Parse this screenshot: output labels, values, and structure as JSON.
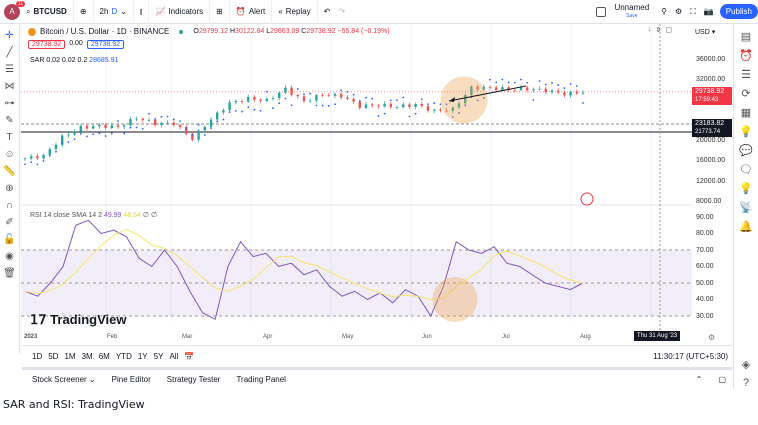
{
  "toolbar": {
    "avatar": "A",
    "badge": "11",
    "symbol": "BTCUSD",
    "interval": "2h",
    "interval_alt": "D",
    "indicators": "Indicators",
    "alert": "Alert",
    "replay": "Replay",
    "layout_name": "Unnamed",
    "save": "Save",
    "publish": "Publish"
  },
  "legend": {
    "title": "Bitcoin / U.S. Dollar · 1D · BINANCE",
    "open_label": "O",
    "open": "29799.12",
    "high_label": "H",
    "high": "30122.84",
    "low_label": "L",
    "low": "29663.09",
    "close_label": "C",
    "close": "29738.92",
    "change": "−55.84 (−0.19%)",
    "bid": "29738.92",
    "spread": "0.00",
    "ask": "29738.92",
    "sar_label": "SAR 0.02 0.02 0.2",
    "sar_value": "28685.91"
  },
  "rsi_legend": {
    "label": "RSI 14 close SMA 14 2",
    "rsi": "49.99",
    "sma": "46.54",
    "extra": "∅ ∅"
  },
  "price_axis": {
    "currency": "USD",
    "ticks": [
      "36000.00",
      "32000.00",
      "20000.00",
      "16000.00",
      "12000.00",
      "8000.00"
    ],
    "last_price": "29738.92",
    "countdown": "17:59:43",
    "cross_price": "23183.82",
    "cross_sub": "21773.74"
  },
  "rsi_axis": {
    "ticks": [
      "90.00",
      "80.00",
      "70.00",
      "60.00",
      "50.00",
      "40.00",
      "30.00"
    ]
  },
  "time_axis": {
    "labels": [
      "2023",
      "Feb",
      "Mar",
      "Apr",
      "May",
      "Jun",
      "Jul",
      "Aug"
    ],
    "crosshair_date": "Thu 31 Aug '23"
  },
  "ranges": [
    "1D",
    "5D",
    "1M",
    "3M",
    "6M",
    "YTD",
    "1Y",
    "5Y",
    "All"
  ],
  "clock": "11:30:17 (UTC+5:30)",
  "bottom_tabs": [
    "Stock Screener",
    "Pine Editor",
    "Strategy Tester",
    "Trading Panel"
  ],
  "watermark": "TradingView",
  "caption": "SAR and RSI: TradingView",
  "colors": {
    "up": "#26a69a",
    "down": "#ef5350",
    "sar": "#2962ff",
    "rsi": "#7e57c2",
    "sma": "#f5e56b",
    "accent": "#2962ff",
    "highlight": "#f0a050"
  },
  "chart_data": {
    "type": "candlestick",
    "weekly_close": [
      16600,
      17100,
      20800,
      22700,
      23000,
      22800,
      24600,
      23500,
      23500,
      20500,
      24300,
      27500,
      28400,
      28000,
      30300,
      27800,
      29200,
      28900,
      26900,
      27100,
      26800,
      27200,
      25900,
      26300,
      30500,
      30500,
      30200,
      30300,
      30000,
      29300,
      29700
    ],
    "rsi": [
      45,
      42,
      50,
      60,
      85,
      88,
      80,
      82,
      78,
      65,
      60,
      70,
      60,
      45,
      32,
      28,
      60,
      75,
      66,
      68,
      60,
      62,
      55,
      58,
      48,
      42,
      45,
      40,
      44,
      38,
      46,
      42,
      30,
      48,
      75,
      70,
      68,
      72,
      62,
      60,
      55,
      50,
      48,
      46,
      50
    ],
    "yrange": [
      8000,
      36000
    ],
    "rsi_range": [
      30,
      90
    ]
  }
}
